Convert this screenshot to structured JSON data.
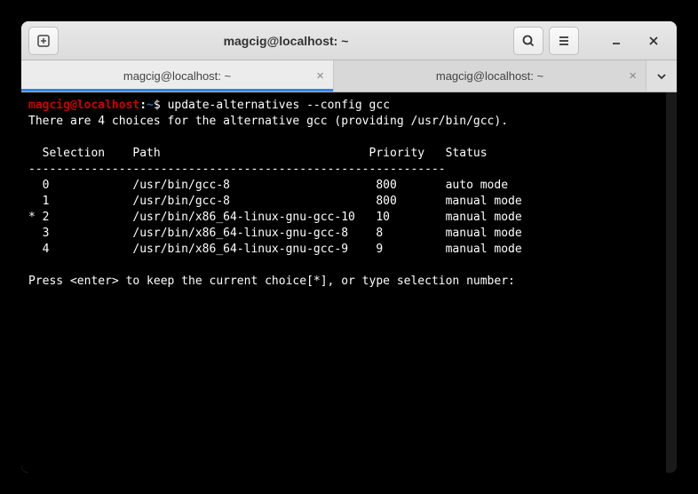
{
  "window": {
    "title": "magcig@localhost: ~"
  },
  "tabs": [
    {
      "label": "magcig@localhost: ~",
      "active": true
    },
    {
      "label": "magcig@localhost: ~",
      "active": false
    }
  ],
  "prompt": {
    "user": "magcig",
    "at": "@",
    "host": "localhost",
    "colon": ":",
    "path": "~",
    "symbol": "$ "
  },
  "command": "update-alternatives --config gcc",
  "output": {
    "intro": "There are 4 choices for the alternative gcc (providing /usr/bin/gcc).",
    "header": "  Selection    Path                              Priority   Status",
    "divider": "------------------------------------------------------------",
    "rows": [
      "  0            /usr/bin/gcc-8                     800       auto mode",
      "  1            /usr/bin/gcc-8                     800       manual mode",
      "* 2            /usr/bin/x86_64-linux-gnu-gcc-10   10        manual mode",
      "  3            /usr/bin/x86_64-linux-gnu-gcc-8    8         manual mode",
      "  4            /usr/bin/x86_64-linux-gnu-gcc-9    9         manual mode"
    ],
    "prompt_line": "Press <enter> to keep the current choice[*], or type selection number:"
  }
}
